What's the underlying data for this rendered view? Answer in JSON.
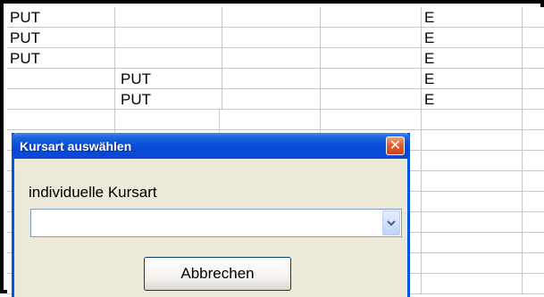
{
  "spreadsheet": {
    "rows": [
      {
        "a": "PUT",
        "b": "",
        "e": "E"
      },
      {
        "a": "PUT",
        "b": "",
        "e": "E"
      },
      {
        "a": "PUT",
        "b": "",
        "e": "E"
      },
      {
        "a": "",
        "b": "PUT",
        "e": "E"
      },
      {
        "a": "",
        "b": "PUT",
        "e": "E"
      }
    ]
  },
  "dialog": {
    "title": "Kursart auswählen",
    "close_icon": "close-icon",
    "label": "individuelle Kursart",
    "combo_value": "",
    "cancel_label": "Abbrechen"
  },
  "colors": {
    "titlebar": "#0a4ed8",
    "close": "#e0602f",
    "dialog_bg": "#ece9d8"
  }
}
